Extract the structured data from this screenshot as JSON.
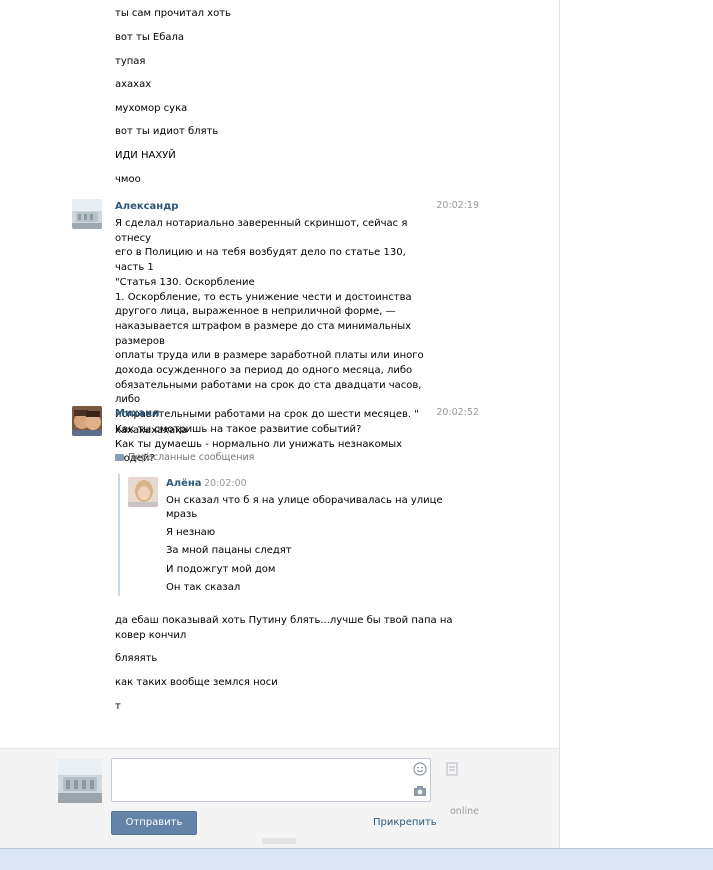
{
  "earlier_messages": [
    "ты сам прочитал хоть",
    "вот ты Ебала",
    "тупая",
    "ахахах",
    "мухомор сука",
    "вот ты идиот блять",
    "ИДИ НАХУЙ",
    "чмоо"
  ],
  "message_alexandr": {
    "author": "Александр",
    "time": "20:02:19",
    "lines": [
      "Я сделал нотариально заверенный скриншот, сейчас я отнесу",
      "его в Полицию и на тебя возбудят дело по статье 130, часть 1",
      "\"Статья 130. Оскорбление",
      "1. Оскорбление, то есть унижение чести и достоинства",
      "другого лица, выраженное в неприличной форме, —",
      "наказывается штрафом в размере до ста минимальных размеров",
      "оплаты труда или в размере заработной платы или иного",
      "дохода осужденного за период до одного месяца, либо",
      "обязательными работами на срок до ста двадцати часов, либо",
      "исправительными работами на срок до шести месяцев. \"",
      "Как ты смотришь на такое развитие событий?",
      "Как ты думаешь - нормально ли унижать незнакомых людей?"
    ]
  },
  "message_mikhail": {
    "author": "Михаил",
    "time": "20:02:52",
    "text": "хахахахахаха",
    "forwarded_label": "Пересланные сообщения",
    "forwarded": {
      "author": "Алёна",
      "time": "20:02:00",
      "lines": [
        "Он сказал что б я на улице оборачивалась на улице",
        "мразь",
        "Я незнаю",
        "За мной пацаны следят",
        "И подожгут мой дом",
        "Он так сказал"
      ]
    },
    "after_lines": [
      "да ебаш показывай хоть Путину блять...лучше бы твой папа на",
      "ковер кончил",
      "бляяять",
      "как таких вообще землся носи",
      "т"
    ]
  },
  "composer": {
    "input_value": "",
    "send_label": "Отправить",
    "attach_label": "Прикрепить",
    "online_label": "online"
  },
  "colors": {
    "author_link": "#2b587a",
    "send_button": "#6383a8",
    "forward_border": "#c9d6e4",
    "bottom_bar": "#dbe6f2"
  }
}
